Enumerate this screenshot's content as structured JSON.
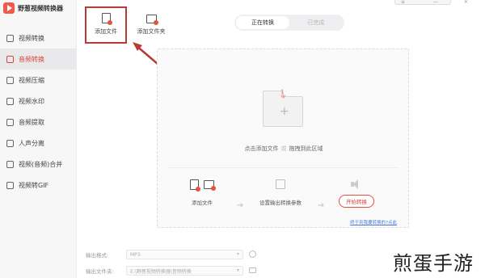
{
  "app": {
    "name": "野葱视频转换器"
  },
  "sidebar": {
    "items": [
      {
        "label": "视频转换",
        "icon": "video-convert-icon",
        "active": false
      },
      {
        "label": "音频转换",
        "icon": "audio-convert-icon",
        "active": true
      },
      {
        "label": "视频压缩",
        "icon": "video-compress-icon",
        "active": false
      },
      {
        "label": "视频水印",
        "icon": "watermark-icon",
        "active": false
      },
      {
        "label": "音频提取",
        "icon": "audio-extract-icon",
        "active": false
      },
      {
        "label": "人声分离",
        "icon": "voice-separate-icon",
        "active": false
      },
      {
        "label": "视频(音频)合并",
        "icon": "merge-icon",
        "active": false
      },
      {
        "label": "视频转GIF",
        "icon": "gif-icon",
        "active": false
      }
    ]
  },
  "toolbar": {
    "add_file": "添加文件",
    "add_folder": "添加文件夹"
  },
  "tabs": [
    {
      "label": "正在转换",
      "active": true
    },
    {
      "label": "已完成",
      "active": false
    }
  ],
  "dropzone": {
    "hint_left": "点击添加文件",
    "hint_sep": "或",
    "hint_right": "拖拽到此区域",
    "step_add": "添加文件",
    "step_settings": "设置输出转换参数",
    "start_button": "开始转换",
    "help_link": "终于到我要转换的?点此"
  },
  "bottom": {
    "format_label": "输出格式:",
    "format_value": "MP3",
    "folder_label": "输出文件夹:",
    "folder_value": "E:\\野葱视频转换器\\音频转换"
  },
  "watermark": "煎蛋手游",
  "colors": {
    "accent": "#d9463a",
    "annotation": "#b83a34"
  }
}
